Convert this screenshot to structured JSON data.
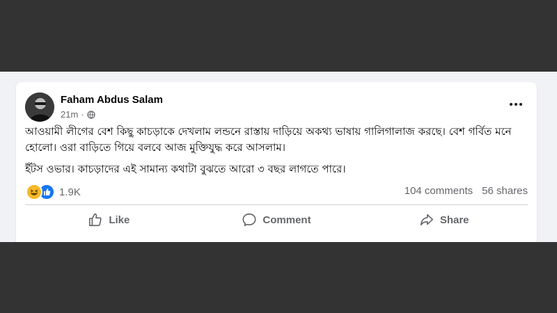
{
  "colors": {
    "background": "#f0f2f5",
    "card": "#ffffff",
    "overlay_band": "#333333",
    "secondary_text": "#65676b",
    "like_blue": "#1877f2",
    "haha_yellow": "#f7b928"
  },
  "post": {
    "author": "Faham Abdus Salam",
    "time": "21m",
    "separator": "·",
    "privacy_icon": "globe-icon",
    "more_icon": "ellipsis-icon",
    "paragraphs": [
      "আওয়ামী লীগের বেশ কিছু কাচড়াকে দেখলাম লন্ডনে রাস্তায় দাড়িয়ে অকথ্য ভাষায় গালিগালাজ করছে। বেশ গর্বিত মনে হোলো। ওরা বাড়িতে গিয়ে বলবে আজ মুক্তিযুদ্ধ করে আসলাম।",
      "ইঁটস ওভার। কাচড়াদের এই সামান্য কথাটা বুঝতে আরো ৩ বছর লাগতে পারে।"
    ],
    "reactions": {
      "icons": [
        "haha-icon",
        "like-icon"
      ],
      "count": "1.9K"
    },
    "comments": "104 comments",
    "shares": "56 shares",
    "actions": {
      "like": "Like",
      "comment": "Comment",
      "share": "Share"
    }
  }
}
